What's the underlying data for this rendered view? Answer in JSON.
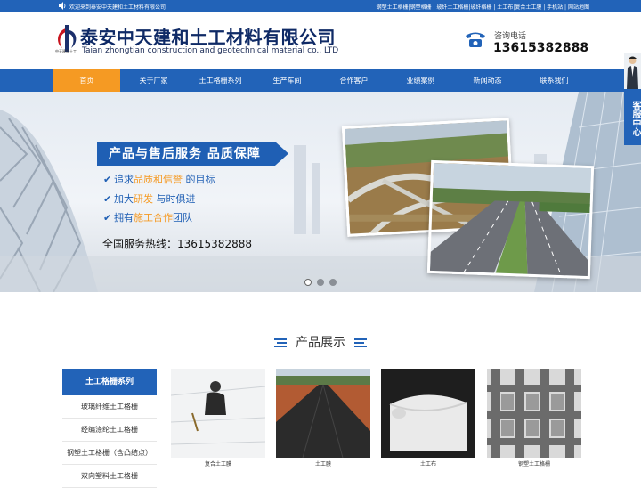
{
  "topbar": {
    "welcome": "欢迎来到泰安中天建和土工材料有限公司",
    "links": "钢塑土工格栅|钢塑格栅 | 玻纤土工格栅|玻纤格栅 | 土工布|复合土工膜 | 手机站 | 网站地图"
  },
  "header": {
    "company_cn": "泰安中天建和土工材料有限公司",
    "company_en": "Taian zhongtian construction and geotechnical material co., LTD",
    "logo_caption": "中天建和土工",
    "phone_label": "咨询电话",
    "phone_number": "13615382888"
  },
  "nav": {
    "items": [
      "首页",
      "关于厂家",
      "土工格栅系列",
      "生产车间",
      "合作客户",
      "业绩案例",
      "新闻动态",
      "联系我们"
    ],
    "active_index": 0
  },
  "banner": {
    "ribbon": "产品与售后服务  品质保障",
    "bullets": [
      {
        "pre": "追求",
        "hl": "品质和信誉",
        "post": " 的目标"
      },
      {
        "pre": "加大",
        "hl": "研发",
        "post": " 与时俱进"
      },
      {
        "pre": "拥有",
        "hl": "施工合作",
        "post": "团队"
      }
    ],
    "hotline": "全国服务热线：13615382888",
    "slide_count": 3,
    "active_slide": 0
  },
  "float_service": {
    "label": "客服中心"
  },
  "products_section": {
    "title": "产品展示"
  },
  "sidebar": {
    "header": "土工格栅系列",
    "items": [
      "玻璃纤维土工格栅",
      "经编涤纶土工格栅",
      "钢塑土工格栅（含凸结点）",
      "双向塑料土工格栅"
    ]
  },
  "products": [
    {
      "name": "复合土工膜",
      "icon": "geomembrane-photo"
    },
    {
      "name": "土工膜",
      "icon": "geomembrane-field-photo"
    },
    {
      "name": "土工布",
      "icon": "geotextile-roll-photo"
    },
    {
      "name": "钢塑土工格栅",
      "icon": "steel-plastic-grid-photo"
    }
  ],
  "colors": {
    "primary": "#2263b8",
    "accent": "#f59a23"
  }
}
